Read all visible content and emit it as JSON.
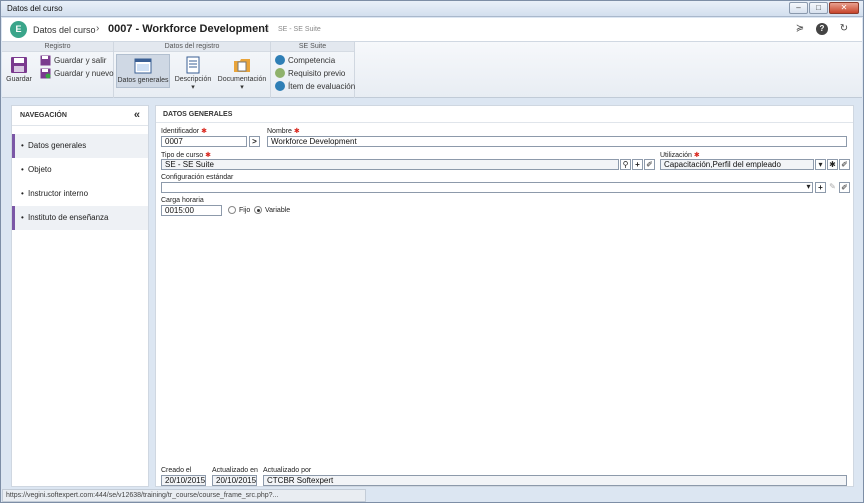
{
  "window": {
    "title": "Datos del curso",
    "controls": [
      "–",
      "□",
      "✕"
    ]
  },
  "header": {
    "logo_letter": "E",
    "crumb_root": "Datos del curso",
    "crumb_sep": "›",
    "record_title": "0007 - Workforce Development",
    "suite_sep": "|",
    "suite": "SE - SE Suite",
    "icon_collapse": "≽",
    "icon_help": "?",
    "icon_refresh": "↻"
  },
  "ribbon": {
    "groups": {
      "registro": "Registro",
      "datos_registro": "Datos del registro",
      "se_suite": "SE Suite"
    },
    "guardar": "Guardar",
    "guardar_salir": "Guardar y salir",
    "guardar_nuevo": "Guardar y nuevo",
    "datos_generales": "Datos generales",
    "descripcion": "Descripción",
    "documentacion": "Documentación",
    "dropdown_arrow": "▾",
    "competencia": "Competencia",
    "requisito_previo": "Requisito previo",
    "item_evaluacion": "Ítem de evaluación"
  },
  "sidebar": {
    "title": "NAVEGACIÓN",
    "collapse": "«",
    "items": [
      {
        "label": "Datos generales"
      },
      {
        "label": "Objeto"
      },
      {
        "label": "Instructor interno"
      },
      {
        "label": "Instituto de enseñanza"
      }
    ]
  },
  "main": {
    "title": "DATOS GENERALES",
    "identificador_label": "Identificador",
    "identificador_value": "0007",
    "next_arrow": ">",
    "nombre_label": "Nombre",
    "nombre_value": "Workforce Development",
    "tipo_label": "Tipo de curso",
    "tipo_value": "SE - SE Suite",
    "utilizacion_label": "Utilización",
    "utilizacion_value": "Capacitación,Perfil del empleado",
    "config_label": "Configuración estándar",
    "config_value": "",
    "carga_label": "Carga horaria",
    "carga_value": "0015:00",
    "fijo_label": "Fijo",
    "variable_label": "Variable",
    "creado_label": "Creado el",
    "creado_value": "20/10/2015",
    "actualizado_en_label": "Actualizado en",
    "actualizado_en_value": "20/10/2015",
    "actualizado_por_label": "Actualizado por",
    "actualizado_por_value": "CTCBR Softexpert",
    "required_mark": "✱",
    "search_glyph": "⚲",
    "plus_glyph": "+",
    "clear_glyph": "✐",
    "chev_glyph": "▾",
    "star_glyph": "✱",
    "edit_glyph": "✎"
  },
  "statusbar": {
    "url": "https://vegini.softexpert.com:444/se/v12638/training/tr_course/course_frame_src.php?..."
  },
  "colors": {
    "accent_purple": "#7b57a6",
    "required_red": "#d9261c",
    "logo_green": "#3aa58a"
  }
}
